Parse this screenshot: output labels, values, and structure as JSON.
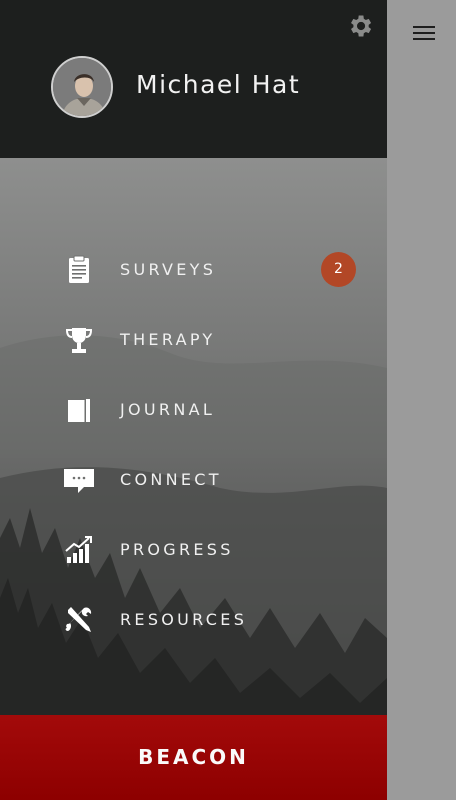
{
  "user": {
    "name": "Michael Hat"
  },
  "menu": {
    "items": [
      {
        "label": "SURVEYS",
        "icon": "clipboard-icon",
        "badge": "2"
      },
      {
        "label": "THERAPY",
        "icon": "trophy-icon"
      },
      {
        "label": "JOURNAL",
        "icon": "journal-book-icon"
      },
      {
        "label": "CONNECT",
        "icon": "chat-bubble-icon"
      },
      {
        "label": "PROGRESS",
        "icon": "bar-chart-icon"
      },
      {
        "label": "RESOURCES",
        "icon": "tools-icon"
      }
    ]
  },
  "footer": {
    "beacon_label": "BEACON"
  },
  "colors": {
    "header_bg": "#1d1f1e",
    "badge": "#b24726",
    "beacon": "#8d0000",
    "right_pane": "#9b9b9b"
  }
}
